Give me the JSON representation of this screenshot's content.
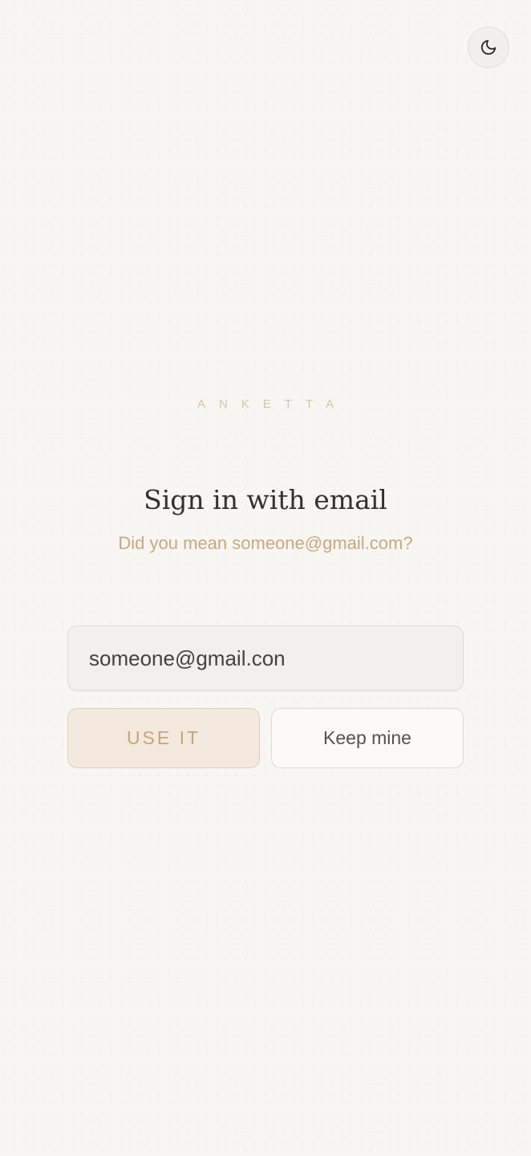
{
  "header": {
    "theme_toggle_icon": "moon-icon"
  },
  "brand": {
    "name": "ANKETTA",
    "color": "#dcc5a0"
  },
  "signin": {
    "title": "Sign in with email",
    "suggestion": "Did you mean someone@gmail.com?",
    "email_value": "someone@gmail.con",
    "use_label": "USE IT",
    "keep_label": "Keep mine"
  },
  "colors": {
    "accent": "#c9a87b",
    "background": "#f8f6f3",
    "text": "#34312c"
  }
}
